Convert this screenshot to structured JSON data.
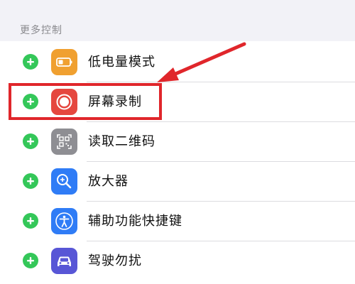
{
  "section": {
    "header": "更多控制"
  },
  "items": [
    {
      "label": "低电量模式",
      "icon": "battery-icon",
      "icon_color": "#f0a030"
    },
    {
      "label": "屏幕录制",
      "icon": "screen-record-icon",
      "icon_color": "#e5473f"
    },
    {
      "label": "读取二维码",
      "icon": "qr-code-icon",
      "icon_color": "#8e8e93"
    },
    {
      "label": "放大器",
      "icon": "magnifier-icon",
      "icon_color": "#2f7cf6"
    },
    {
      "label": "辅助功能快捷键",
      "icon": "accessibility-icon",
      "icon_color": "#2f7cf6"
    },
    {
      "label": "驾驶勿扰",
      "icon": "car-icon",
      "icon_color": "#5856d6"
    }
  ],
  "colors": {
    "add_button": "#34c759",
    "annotation": "#e0262b",
    "background": "#f2f2f7"
  }
}
